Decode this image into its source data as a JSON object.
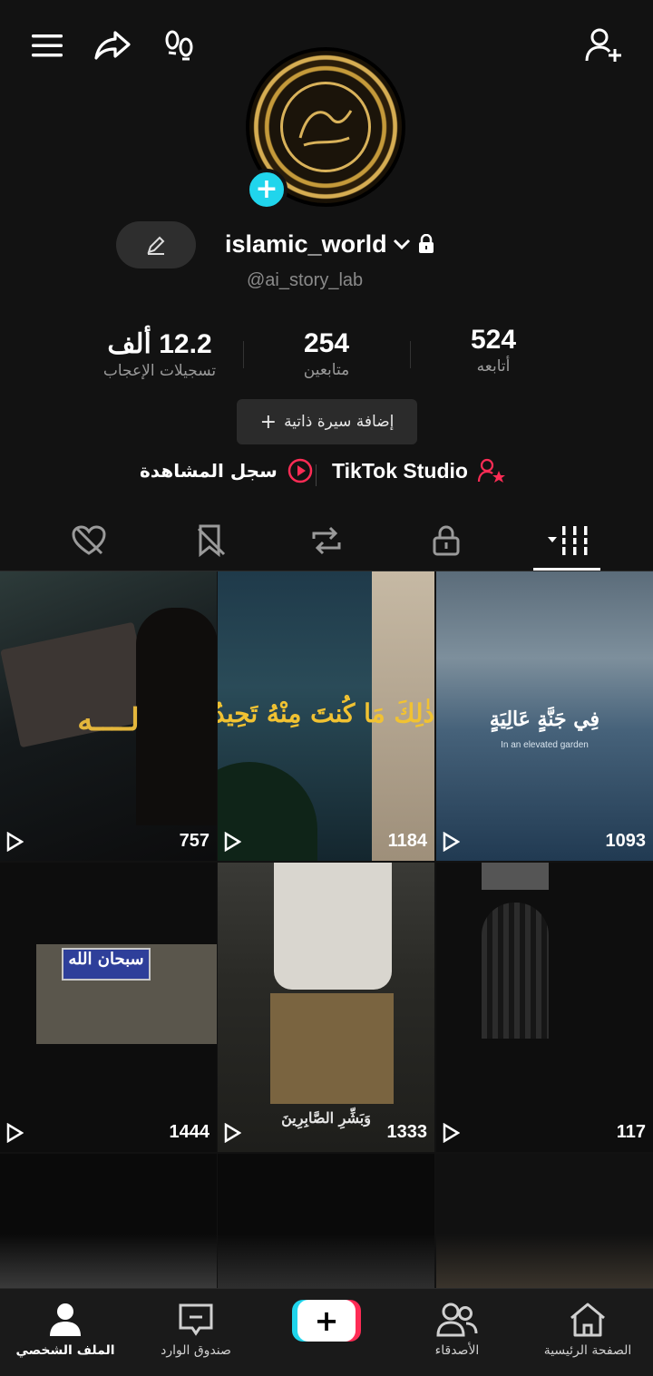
{
  "profile": {
    "username": "islamic_world",
    "handle": "@ai_story_lab",
    "stats": [
      {
        "value": "12.2 ألف",
        "label": "تسجيلات الإعجاب"
      },
      {
        "value": "254",
        "label": "متابعين"
      },
      {
        "value": "524",
        "label": "أتابعه"
      }
    ],
    "add_bio_label": "إضافة سيرة ذاتية",
    "watch_history_label": "سجل المشاهدة",
    "studio_label": "TikTok Studio"
  },
  "videos": [
    {
      "views": "757",
      "caption": "لــــه"
    },
    {
      "views": "1184",
      "caption": "ذٰلِكَ مَا كُنتَ مِنْهُ تَحِيدُ"
    },
    {
      "views": "1093",
      "caption": "فِي جَنَّةٍ عَالِيَةٍ",
      "subcaption": "In an elevated garden"
    },
    {
      "views": "1444",
      "caption": "سبحان الله"
    },
    {
      "views": "1333",
      "caption": "وَبَشِّرِ الصَّابِرِينَ"
    },
    {
      "views": "117",
      "caption": ""
    }
  ],
  "bottom_nav": {
    "profile": "الملف الشخصي",
    "inbox": "صندوق الوارد",
    "friends": "الأصدقاء",
    "home": "الصفحة الرئيسية"
  },
  "colors": {
    "accent_cyan": "#20d5ec",
    "accent_red": "#fe2c55",
    "background": "#121212"
  }
}
